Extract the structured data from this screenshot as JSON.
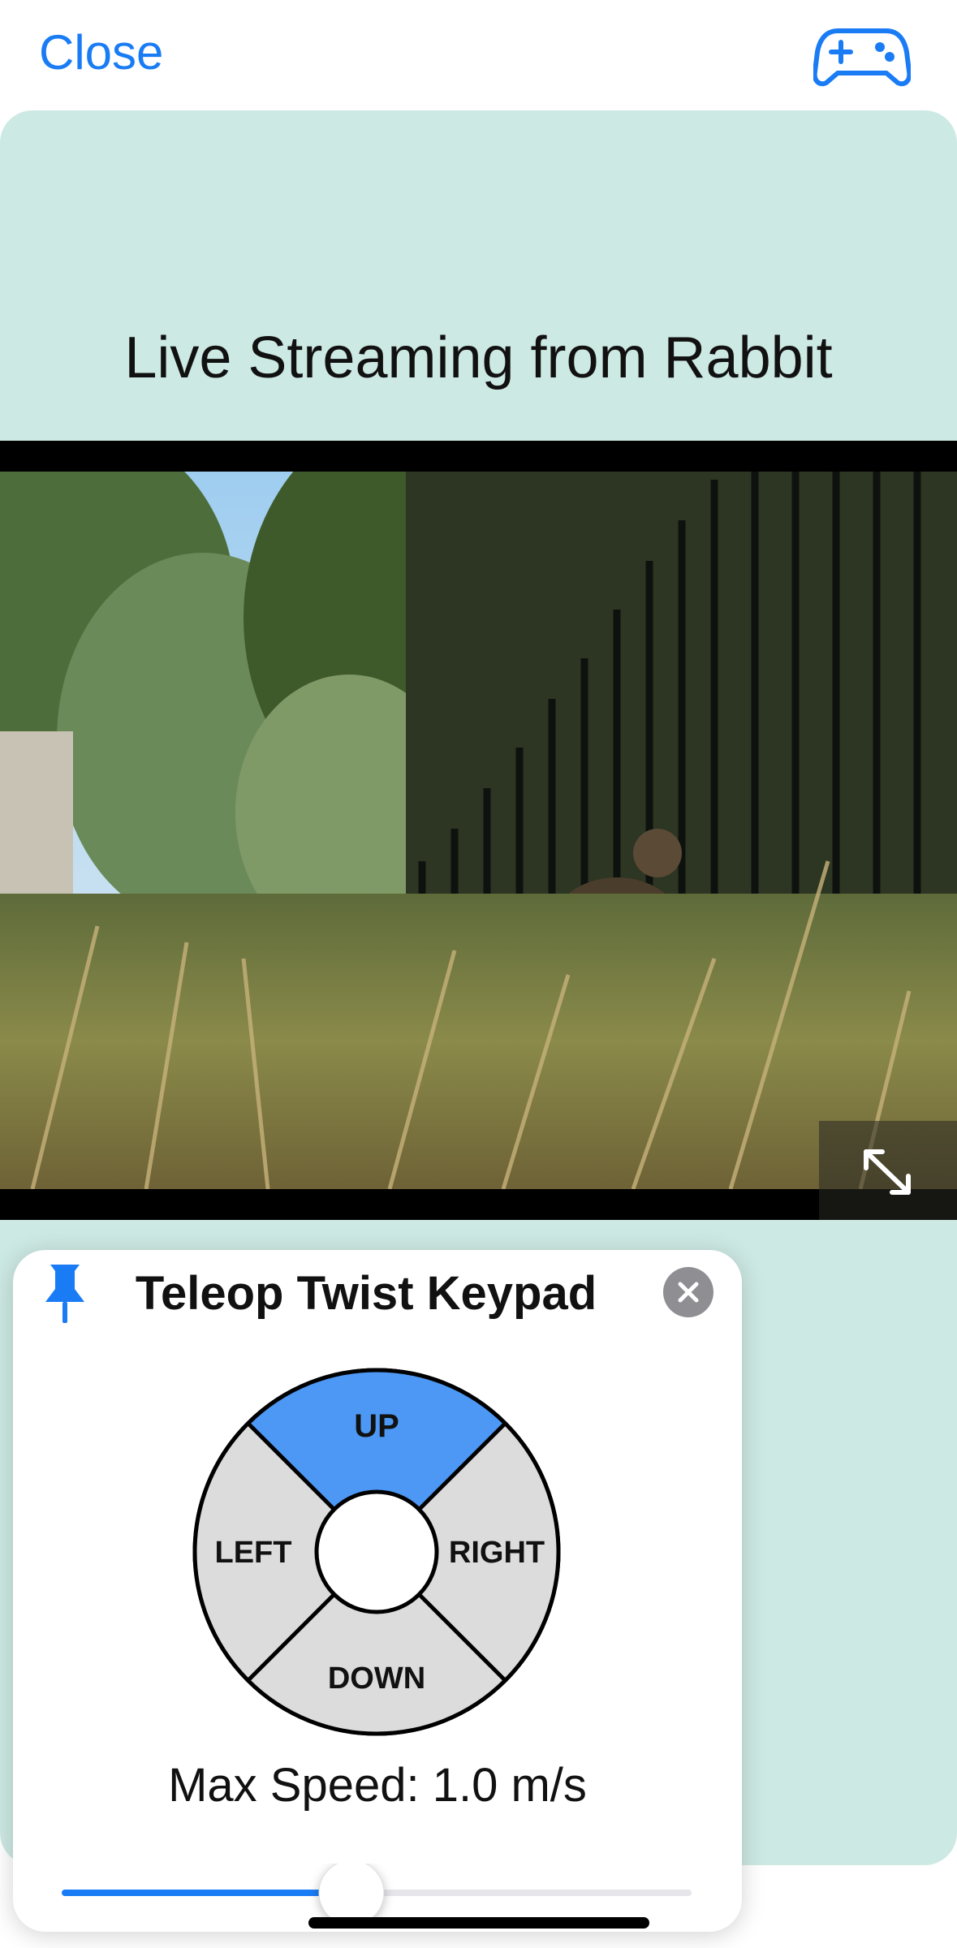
{
  "nav": {
    "close_label": "Close",
    "controller_icon": "gamepad-icon"
  },
  "stream": {
    "title": "Live Streaming from Rabbit",
    "expand_icon": "expand-icon"
  },
  "keypad": {
    "title": "Teleop Twist Keypad",
    "pin_icon": "pin-icon",
    "close_icon": "close-circle-icon",
    "buttons": {
      "up": "UP",
      "left": "LEFT",
      "right": "RIGHT",
      "down": "DOWN"
    },
    "active_direction": "up",
    "speed_label": "Max Speed: 1.0 m/s",
    "speed_slider_fraction": 0.46
  },
  "colors": {
    "accent": "#1a7cf5",
    "panel_bg": "#cde9e3",
    "active_segment": "#4d98f4",
    "inactive_segment": "#dcdcdc"
  }
}
